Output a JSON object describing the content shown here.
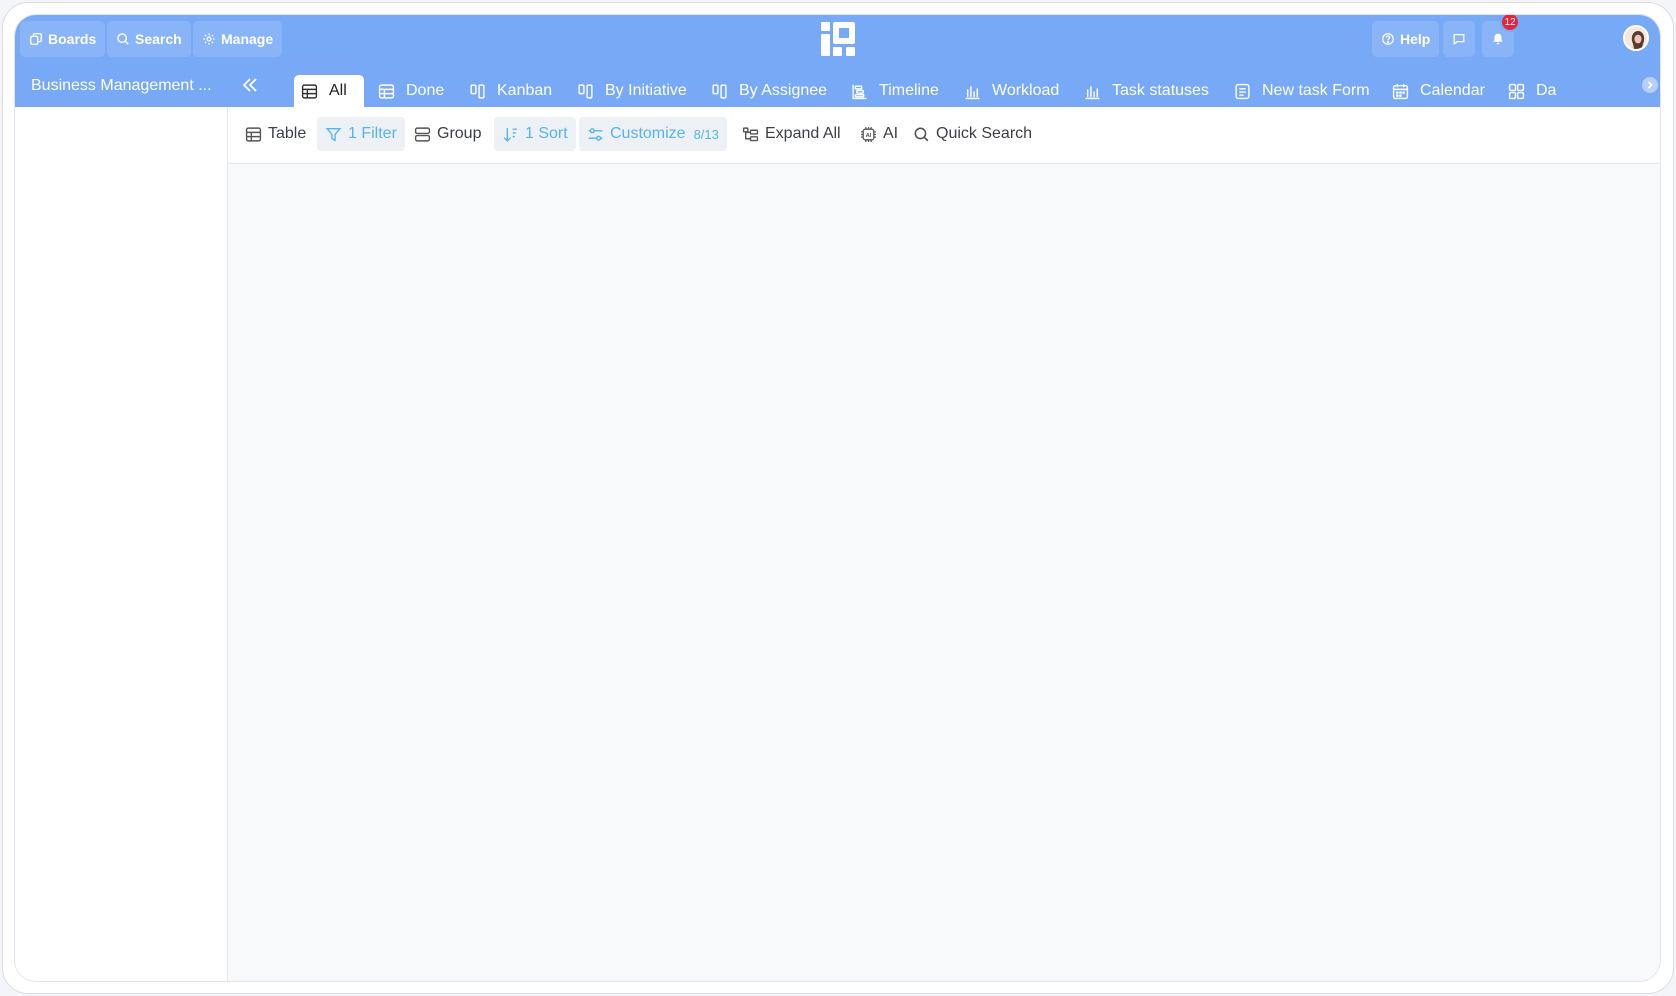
{
  "topbar": {
    "boards_label": "Boards",
    "search_label": "Search",
    "manage_label": "Manage",
    "help_label": "Help",
    "notification_count": "12"
  },
  "board": {
    "title": "Business Management ..."
  },
  "tabs": [
    {
      "label": "All",
      "icon": "table-icon",
      "active": true
    },
    {
      "label": "Done",
      "icon": "table-icon"
    },
    {
      "label": "Kanban",
      "icon": "kanban-icon"
    },
    {
      "label": "By Initiative",
      "icon": "kanban-icon"
    },
    {
      "label": "By Assignee",
      "icon": "kanban-icon"
    },
    {
      "label": "Timeline",
      "icon": "timeline-icon"
    },
    {
      "label": "Workload",
      "icon": "bar-chart-icon"
    },
    {
      "label": "Task statuses",
      "icon": "bar-chart-icon"
    },
    {
      "label": "New task Form",
      "icon": "form-icon"
    },
    {
      "label": "Calendar",
      "icon": "calendar-icon"
    },
    {
      "label": "Da",
      "icon": "dashboard-icon"
    }
  ],
  "toolbar": {
    "table_label": "Table",
    "filter_label": "1 Filter",
    "group_label": "Group",
    "sort_label": "1 Sort",
    "customize_label": "Customize",
    "customize_count": "8/13",
    "expand_label": "Expand All",
    "ai_label": "AI",
    "quick_search_label": "Quick Search"
  },
  "colors": {
    "header_bg": "#78a9f7",
    "accent": "#58b4ea",
    "badge": "#e5243b"
  }
}
